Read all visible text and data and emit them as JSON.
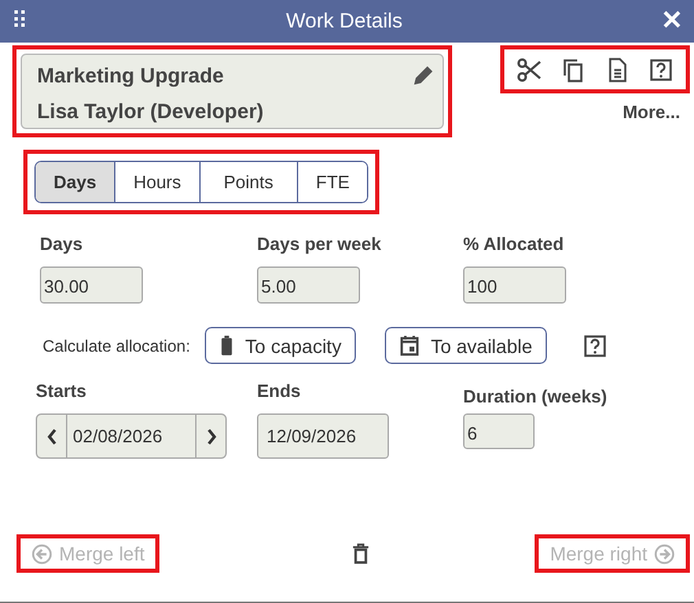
{
  "window": {
    "title": "Work Details",
    "menu_glyph": "⠿",
    "close_glyph": "✕"
  },
  "work_card": {
    "highlighted": true,
    "project": "Marketing Upgrade",
    "person": "Lisa Taylor (Developer)"
  },
  "toolbar": {
    "highlighted": true,
    "more": "More..."
  },
  "unit_tabs": {
    "highlighted": true,
    "items": [
      {
        "label": "Days",
        "selected": true
      },
      {
        "label": "Hours",
        "selected": false
      },
      {
        "label": "Points",
        "selected": false
      },
      {
        "label": "FTE",
        "selected": false
      }
    ]
  },
  "fields": [
    {
      "label": "Days",
      "value": "30.00"
    },
    {
      "label": "Days per week",
      "value": "5.00"
    },
    {
      "label": "% Allocated",
      "value": "100"
    }
  ],
  "calculate": {
    "label": "Calculate allocation:",
    "buttons": [
      {
        "kind": "capacity",
        "label": "To capacity"
      },
      {
        "kind": "available",
        "label": "To available"
      }
    ]
  },
  "starts": {
    "label": "Starts",
    "value": "02/08/2026"
  },
  "ends": {
    "label": "Ends",
    "value": "12/09/2026"
  },
  "duration": {
    "label": "Duration (weeks)",
    "value": "6"
  },
  "merge_left": {
    "label": "Merge left",
    "disabled": true,
    "highlighted": true
  },
  "merge_right": {
    "label": "Merge right",
    "disabled": true,
    "highlighted": true
  }
}
